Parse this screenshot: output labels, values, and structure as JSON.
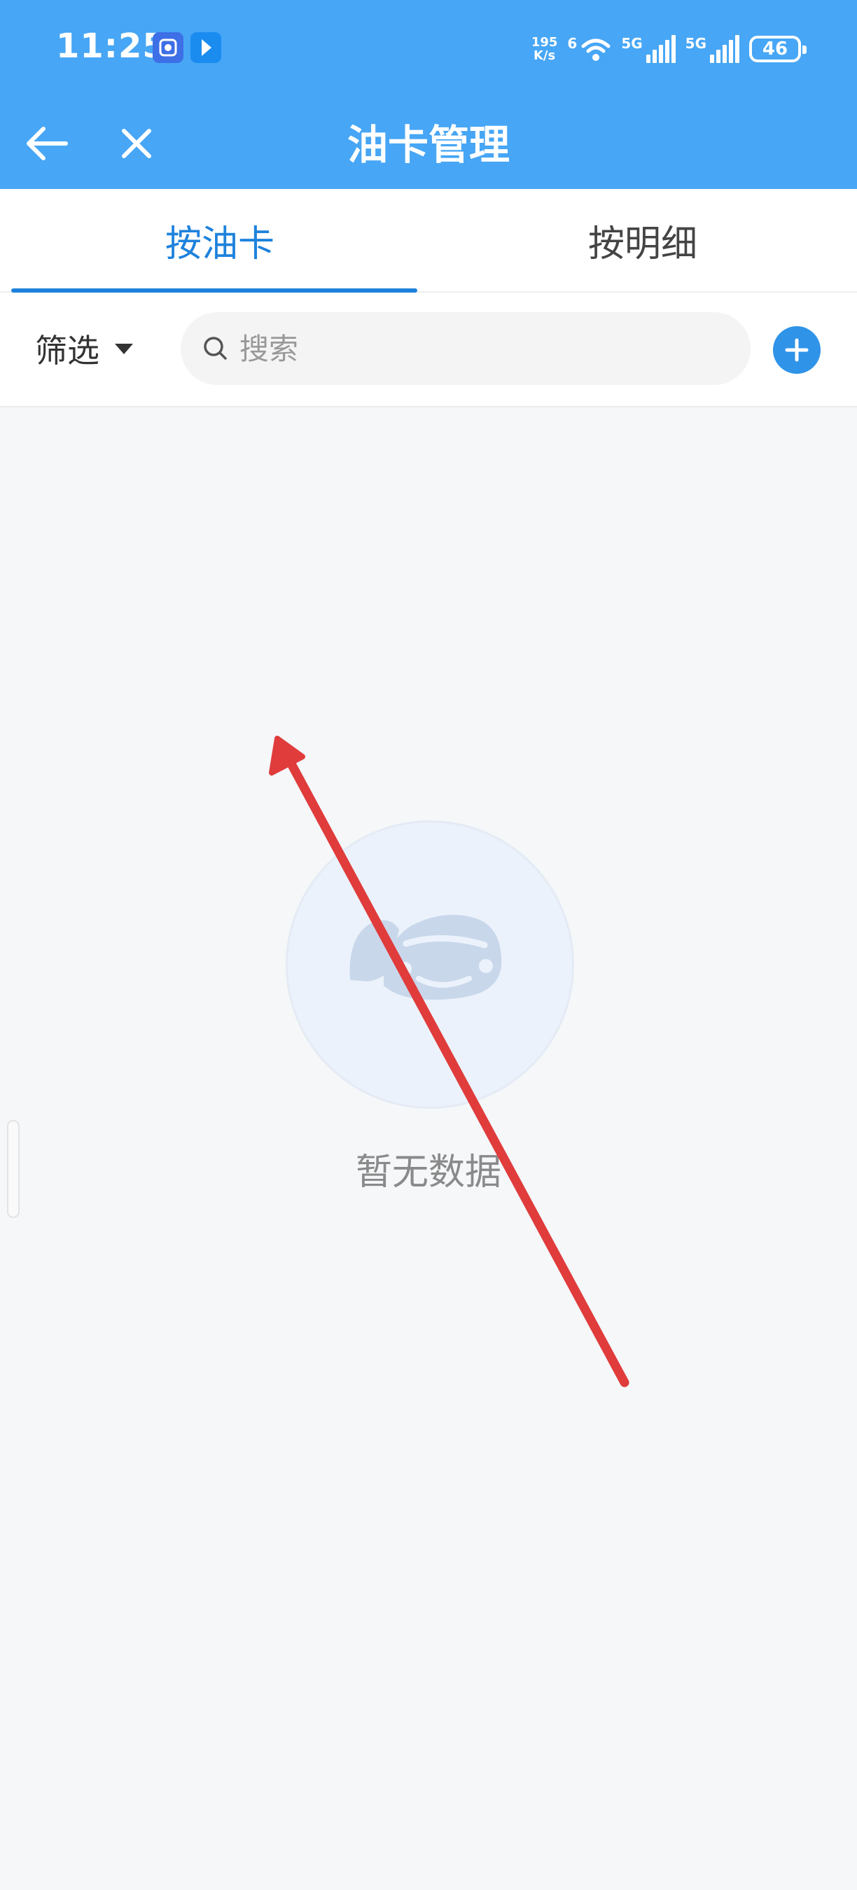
{
  "status_bar": {
    "time": "11:25",
    "net_speed_value": "195",
    "net_speed_unit": "K/s",
    "wifi_label": "6",
    "signal1_label": "5G",
    "signal2_label": "5G",
    "battery": "46"
  },
  "nav": {
    "title": "油卡管理",
    "back_icon": "arrow-left-icon",
    "close_icon": "close-icon"
  },
  "tabs": [
    {
      "label": "按油卡",
      "active": true
    },
    {
      "label": "按明细",
      "active": false
    }
  ],
  "toolbar": {
    "filter_label": "筛选",
    "search_placeholder": "搜索",
    "add_icon": "plus-circle-icon"
  },
  "empty_state": {
    "icon": "car-icon",
    "message": "暂无数据"
  },
  "colors": {
    "header": "#47a6f5",
    "accent": "#1e82dc",
    "add_button": "#2f93e8",
    "annotation_arrow": "#e03c3c"
  }
}
